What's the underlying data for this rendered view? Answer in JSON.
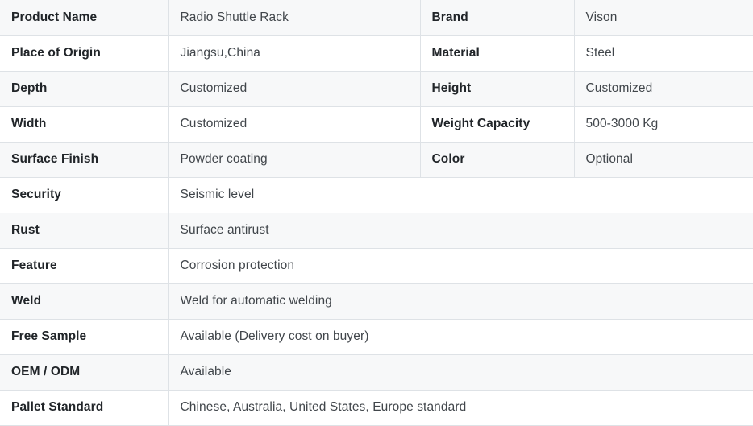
{
  "table": {
    "paired_rows": [
      {
        "label_left": "Product Name",
        "value_left": "Radio Shuttle Rack",
        "label_right": "Brand",
        "value_right": "Vison"
      },
      {
        "label_left": "Place of Origin",
        "value_left": "Jiangsu,China",
        "label_right": "Material",
        "value_right": "Steel"
      },
      {
        "label_left": "Depth",
        "value_left": "Customized",
        "label_right": "Height",
        "value_right": "Customized"
      },
      {
        "label_left": "Width",
        "value_left": "Customized",
        "label_right": "Weight Capacity",
        "value_right": "500-3000 Kg"
      },
      {
        "label_left": "Surface Finish",
        "value_left": "Powder coating",
        "label_right": "Color",
        "value_right": "Optional"
      }
    ],
    "full_rows": [
      {
        "label": "Security",
        "value": "Seismic level"
      },
      {
        "label": "Rust",
        "value": "Surface antirust"
      },
      {
        "label": "Feature",
        "value": "Corrosion protection"
      },
      {
        "label": "Weld",
        "value": "Weld for automatic welding"
      },
      {
        "label": "Free Sample",
        "value": "Available (Delivery cost on buyer)"
      },
      {
        "label": "OEM / ODM",
        "value": "Available"
      },
      {
        "label": "Pallet Standard",
        "value": "Chinese, Australia, United States, Europe standard"
      }
    ]
  },
  "colors": {
    "row_shaded_background": "#f7f8f9",
    "row_plain_background": "#ffffff",
    "border": "#dee2e6",
    "label_text": "#212529",
    "value_text": "#41464b"
  }
}
